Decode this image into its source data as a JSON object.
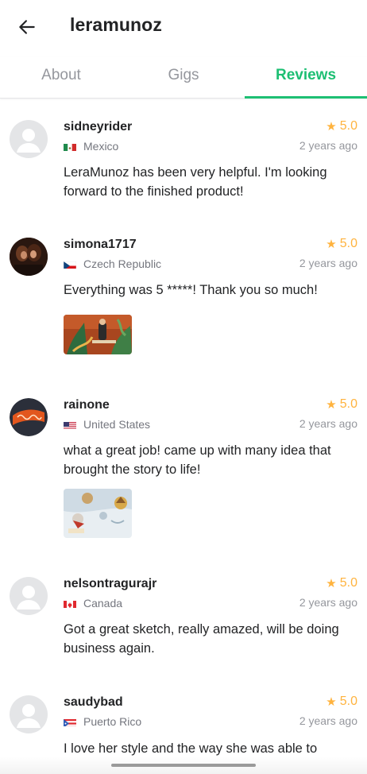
{
  "header": {
    "title": "leramunoz",
    "back_icon": "arrow-left-icon"
  },
  "tabs": [
    {
      "label": "About",
      "active": false
    },
    {
      "label": "Gigs",
      "active": false
    },
    {
      "label": "Reviews",
      "active": true
    }
  ],
  "colors": {
    "accent": "#1dbf73",
    "star": "#ffb33e",
    "muted": "#95979d",
    "text": "#222325"
  },
  "reviews": [
    {
      "username": "sidneyrider",
      "country": "Mexico",
      "flag": "mexico-flag-icon",
      "rating": "5.0",
      "time": "2 years ago",
      "text": "LeraMunoz has been very helpful.  I'm looking forward to the finished product!",
      "avatar": "default-avatar-icon"
    },
    {
      "username": "simona1717",
      "country": "Czech Republic",
      "flag": "czech-flag-icon",
      "rating": "5.0",
      "time": "2 years ago",
      "text": "Everything was 5 *****! Thank you so much!",
      "avatar": "photo-avatar"
    },
    {
      "username": "rainone",
      "country": "United States",
      "flag": "us-flag-icon",
      "rating": "5.0",
      "time": "2 years ago",
      "text": "what a great job! came up with many idea that brought the story to life!",
      "avatar": "logo-avatar"
    },
    {
      "username": "nelsontragurajr",
      "country": "Canada",
      "flag": "canada-flag-icon",
      "rating": "5.0",
      "time": "2 years ago",
      "text": "Got a great sketch, really amazed, will be doing business again.",
      "avatar": "default-avatar-icon"
    },
    {
      "username": "saudybad",
      "country": "Puerto Rico",
      "flag": "puerto-rico-flag-icon",
      "rating": "5.0",
      "time": "2 years ago",
      "text": "I love her style and the way she was able to",
      "avatar": "default-avatar-icon"
    }
  ]
}
